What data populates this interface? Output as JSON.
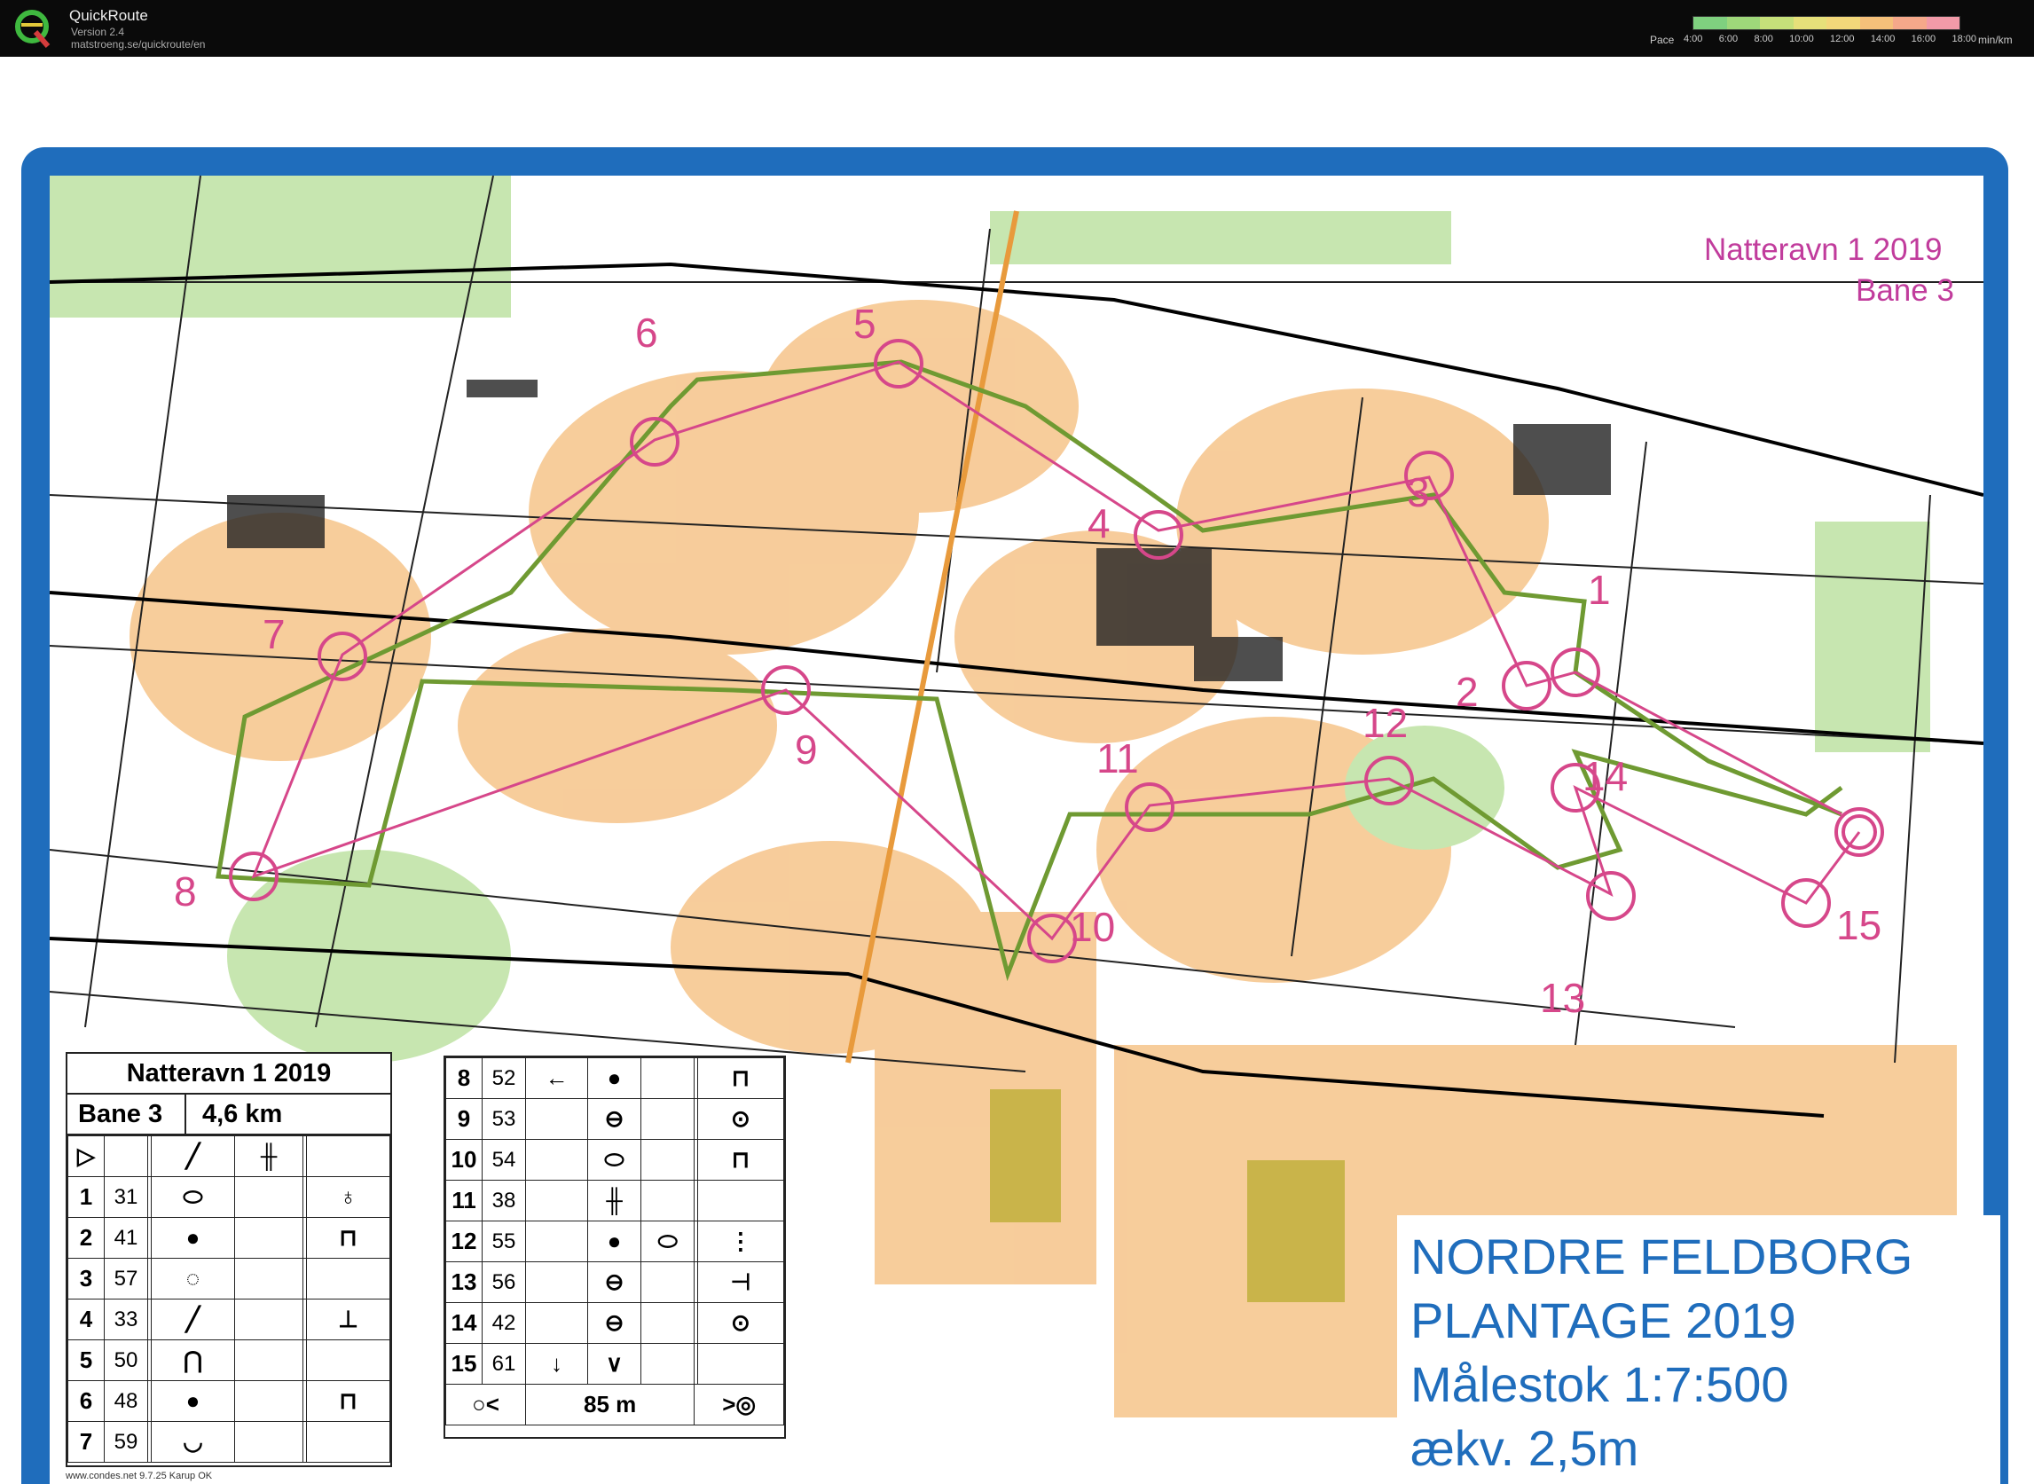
{
  "app": {
    "name": "QuickRoute",
    "version": "Version 2.4",
    "url": "matstroeng.se/quickroute/en"
  },
  "pace_legend": {
    "label": "Pace",
    "ticks": [
      "4:00",
      "6:00",
      "8:00",
      "10:00",
      "12:00",
      "14:00",
      "16:00",
      "18:00"
    ],
    "unit": "min/km",
    "colors": [
      "#7fd07f",
      "#9ed77a",
      "#c6e07a",
      "#e6e07a",
      "#f2d77a",
      "#f5c07a",
      "#f5a88a",
      "#f29aa8"
    ]
  },
  "map": {
    "event_title": "Natteravn 1 2019",
    "course_title": "Bane 3",
    "area_name_line1": "NORDRE FELDBORG",
    "area_name_line2": "PLANTAGE 2019",
    "scale": "Målestok 1:7:500",
    "contour": "ækv. 2,5m",
    "credit": "www.condes.net 9.7.25 Karup OK",
    "colors": {
      "frame": "#1f6dbc",
      "course": "#d6478a",
      "route": "#6f9a32",
      "open": "#f5b36e",
      "forest_green": "#bfe0a8"
    },
    "control_labels": [
      "1",
      "2",
      "3",
      "4",
      "5",
      "6",
      "7",
      "8",
      "9",
      "10",
      "11",
      "12",
      "13",
      "14",
      "15"
    ]
  },
  "description_left": {
    "title": "Natteravn 1 2019",
    "course": "Bane 3",
    "length": "4,6 km",
    "rows": [
      {
        "num": "1",
        "code": "31"
      },
      {
        "num": "2",
        "code": "41"
      },
      {
        "num": "3",
        "code": "57"
      },
      {
        "num": "4",
        "code": "33"
      },
      {
        "num": "5",
        "code": "50"
      },
      {
        "num": "6",
        "code": "48"
      },
      {
        "num": "7",
        "code": "59"
      }
    ]
  },
  "description_right": {
    "rows": [
      {
        "num": "8",
        "code": "52"
      },
      {
        "num": "9",
        "code": "53"
      },
      {
        "num": "10",
        "code": "54"
      },
      {
        "num": "11",
        "code": "38"
      },
      {
        "num": "12",
        "code": "55"
      },
      {
        "num": "13",
        "code": "56"
      },
      {
        "num": "14",
        "code": "42"
      },
      {
        "num": "15",
        "code": "61"
      }
    ],
    "finish_distance": "85 m"
  }
}
